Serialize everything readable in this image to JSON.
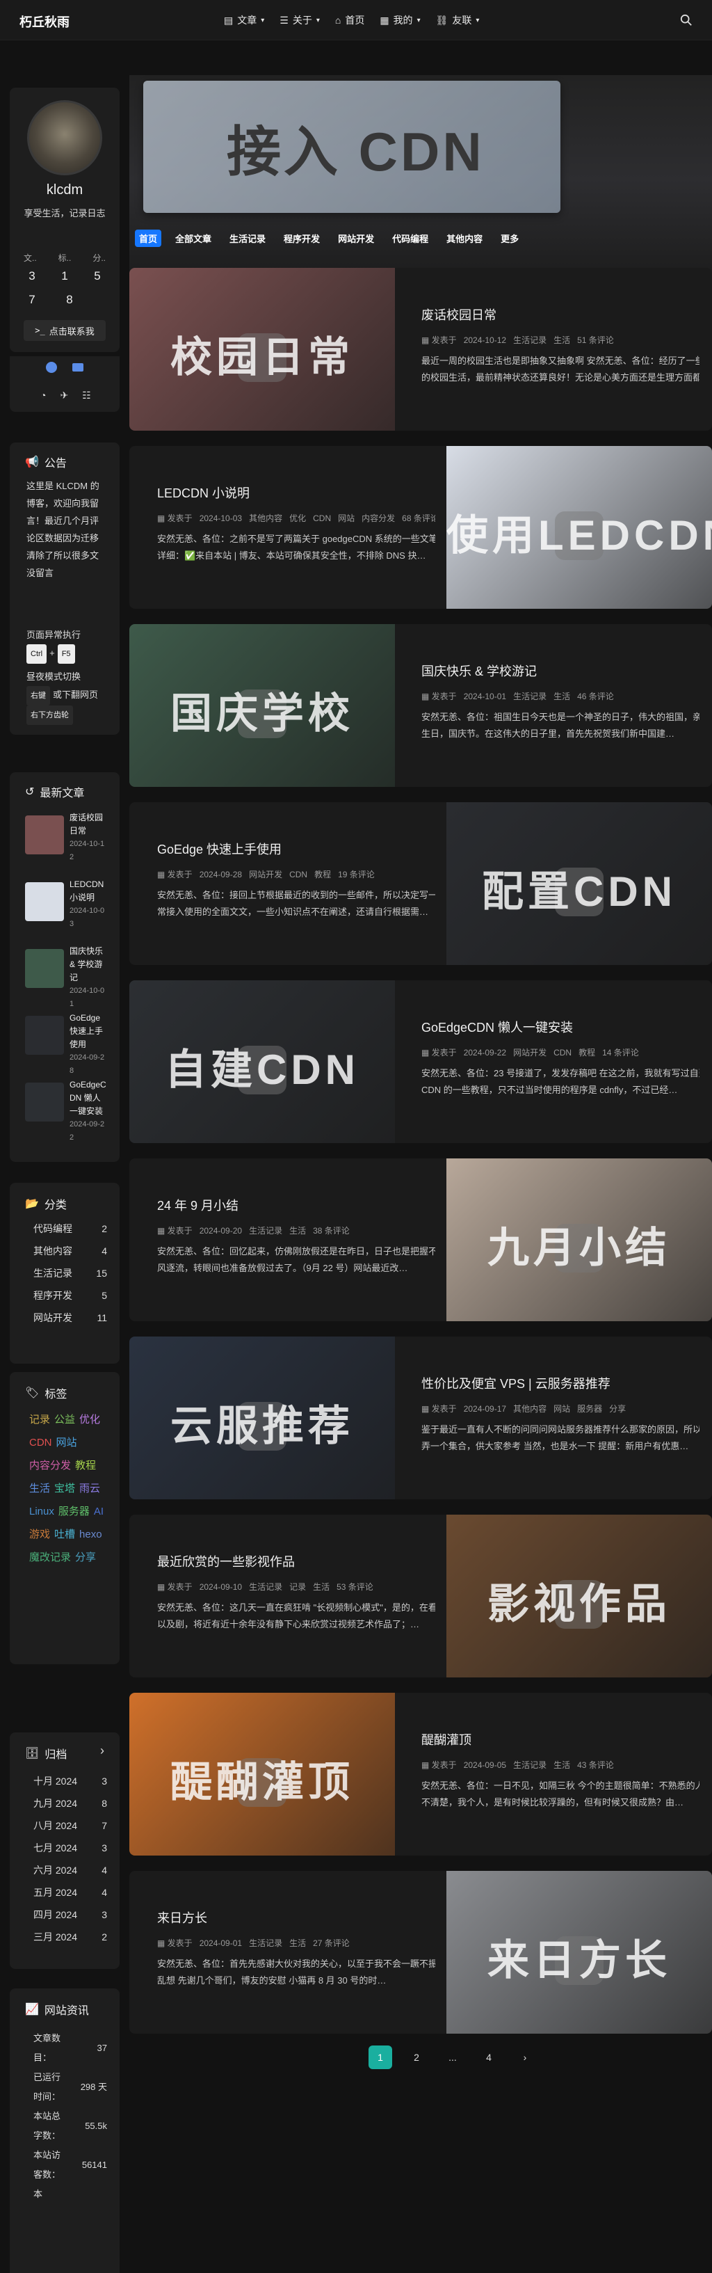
{
  "site": {
    "brand": "朽丘秋雨"
  },
  "nav": {
    "items": [
      {
        "label": "文章",
        "icon": "book-icon",
        "dropdown": true
      },
      {
        "label": "关于",
        "icon": "list-icon",
        "dropdown": true
      },
      {
        "label": "首页",
        "icon": "home-icon",
        "dropdown": false
      },
      {
        "label": "我的",
        "icon": "grid-icon",
        "dropdown": true
      },
      {
        "label": "友联",
        "icon": "link-icon",
        "dropdown": true
      }
    ]
  },
  "hero": {
    "text": "接入 CDN"
  },
  "profile": {
    "name": "klcdm",
    "bio": "享受生活，记录日志",
    "stat_labels": [
      "文..",
      "标..",
      "分.."
    ],
    "stat_values_1": [
      "3",
      "1",
      "5"
    ],
    "stat_values_2": [
      "7",
      "8"
    ],
    "contact_label": "点击联系我"
  },
  "notice": {
    "title": "公告",
    "text": "这里是 KLCDM 的博客，欢迎向我留言！最近几个月评论区数据因为迁移清除了所以很多文没留言",
    "shortcut_label": "页面异常执行",
    "key1": "Ctrl",
    "plus": "+",
    "key2": "F5",
    "theme_label": "昼夜模式切换",
    "btn1": "右键",
    "theme_rest": "或下翻网页",
    "btn2": "右下方齿轮"
  },
  "recent": {
    "title": "最新文章",
    "items": [
      {
        "title": "废话校园日常",
        "date": "2024-10-12"
      },
      {
        "title": "LEDCDN 小说明",
        "date": "2024-10-03"
      },
      {
        "title": "国庆快乐 & 学校游记",
        "date": "2024-10-01"
      },
      {
        "title": "GoEdge 快速上手使用",
        "date": "2024-09-28"
      },
      {
        "title": "GoEdgeCDN 懒人一键安装",
        "date": "2024-09-22"
      }
    ]
  },
  "categories": {
    "title": "分类",
    "items": [
      {
        "name": "代码编程",
        "count": "2"
      },
      {
        "name": "其他内容",
        "count": "4"
      },
      {
        "name": "生活记录",
        "count": "15"
      },
      {
        "name": "程序开发",
        "count": "5"
      },
      {
        "name": "网站开发",
        "count": "11"
      }
    ]
  },
  "tags": {
    "title": "标签",
    "items": [
      {
        "name": "记录",
        "color": "#c8a84a"
      },
      {
        "name": "公益",
        "color": "#7bbf5c"
      },
      {
        "name": "优化",
        "color": "#b77be0"
      },
      {
        "name": "CDN",
        "color": "#e05050"
      },
      {
        "name": "网站",
        "color": "#4aa3e0"
      },
      {
        "name": "内容分发",
        "color": "#d05fa8"
      },
      {
        "name": "教程",
        "color": "#a3d04a"
      },
      {
        "name": "生活",
        "color": "#5f8fe0"
      },
      {
        "name": "宝塔",
        "color": "#3fbfa0"
      },
      {
        "name": "雨云",
        "color": "#8a7be0"
      },
      {
        "name": "Linux",
        "color": "#4a90d0"
      },
      {
        "name": "服务器",
        "color": "#5fbf6a"
      },
      {
        "name": "AI",
        "color": "#4a70d0"
      },
      {
        "name": "游戏",
        "color": "#c87a3a"
      },
      {
        "name": "吐槽",
        "color": "#4ab0d0"
      },
      {
        "name": "hexo",
        "color": "#6a8ad0"
      },
      {
        "name": "魔改记录",
        "color": "#4ab07a"
      },
      {
        "name": "分享",
        "color": "#4aa0c0"
      }
    ]
  },
  "archive": {
    "title": "归档",
    "items": [
      {
        "month": "十月 2024",
        "count": "3"
      },
      {
        "month": "九月 2024",
        "count": "8"
      },
      {
        "month": "八月 2024",
        "count": "7"
      },
      {
        "month": "七月 2024",
        "count": "3"
      },
      {
        "month": "六月 2024",
        "count": "4"
      },
      {
        "month": "五月 2024",
        "count": "4"
      },
      {
        "month": "四月 2024",
        "count": "3"
      },
      {
        "month": "三月 2024",
        "count": "2"
      }
    ]
  },
  "siteinfo": {
    "title": "网站资讯",
    "items": [
      {
        "label": "文章数目：",
        "value": "37"
      },
      {
        "label": "已运行时间：",
        "value": "298 天"
      },
      {
        "label": "本站总字数：",
        "value": "55.5k"
      },
      {
        "label": "本站访客数：",
        "value": "56141"
      },
      {
        "label": "本",
        "value": ""
      }
    ]
  },
  "tabs": [
    "首页",
    "全部文章",
    "生活记录",
    "程序开发",
    "网站开发",
    "代码编程",
    "其他内容",
    "更多"
  ],
  "posts": [
    {
      "title": "废话校园日常",
      "date": "2024-10-12",
      "category": "生活记录",
      "tags": [
        "生活"
      ],
      "comments": "51 条评论",
      "excerpt": "最近一周的校园生活也是即抽象又抽象啊 安然无恙、各位：经历了一些学校的校园生活，最前精神状态还算良好！无论是心美方面还是生理方面都…",
      "thumb": "校园日常",
      "thumb_bg": "#7a5050",
      "side": "left"
    },
    {
      "title": "LEDCDN 小说明",
      "date": "2024-10-03",
      "category": "其他内容",
      "tags": [
        "优化",
        "CDN",
        "网站",
        "内容分发"
      ],
      "comments": "68 条评论",
      "excerpt": "安然无恙、各位：之前不是写了两篇关于 goedgeCDN 系统的一些文笔吗，详细：✅来自本站 | 博友、本站可确保其安全性，不排除 DNS 抉…",
      "thumb": "使用LEDCDN",
      "thumb_bg": "#d8dde6",
      "side": "right"
    },
    {
      "title": "国庆快乐 & 学校游记",
      "date": "2024-10-01",
      "category": "生活记录",
      "tags": [
        "生活"
      ],
      "comments": "46 条评论",
      "excerpt": "安然无恙、各位：祖国生日今天也是一个神圣的日子，伟大的祖国，亲爱的生日，国庆节。在这伟大的日子里，首先先祝贺我们新中国建…",
      "thumb": "国庆学校",
      "thumb_bg": "#3e5a4a",
      "side": "left"
    },
    {
      "title": "GoEdge 快速上手使用",
      "date": "2024-09-28",
      "category": "网站开发",
      "tags": [
        "CDN",
        "教程"
      ],
      "comments": "19 条评论",
      "excerpt": "安然无恙、各位：接回上节根据最近的收到的一些邮件，所以决定写一篇正常接入使用的全面文文，一些小知识点不在阐述，还请自行根据需…",
      "thumb": "配置CDN",
      "thumb_bg": "#2a2c30",
      "side": "right"
    },
    {
      "title": "GoEdgeCDN 懒人一键安装",
      "date": "2024-09-22",
      "category": "网站开发",
      "tags": [
        "CDN",
        "教程"
      ],
      "comments": "14 条评论",
      "excerpt": "安然无恙、各位：23 号接道了，发发存稿吧 在这之前，我就有写过自建 CDN 的一些教程，只不过当时使用的程序是 cdnfly，不过已经…",
      "thumb": "自建CDN",
      "thumb_bg": "#2c2f33",
      "side": "left"
    },
    {
      "title": "24 年 9 月小结",
      "date": "2024-09-20",
      "category": "生活记录",
      "tags": [
        "生活"
      ],
      "comments": "38 条评论",
      "excerpt": "安然无恙、各位：回忆起来，仿佛刚放假还是在昨日，日子也是把握不住随风逐流，转眼间也准备放假过去了。（9月 22 号）网站最近改…",
      "thumb": "九月小结",
      "thumb_bg": "#b8a89a",
      "side": "right"
    },
    {
      "title": "性价比及便宜 VPS | 云服务器推荐",
      "date": "2024-09-17",
      "category": "其他内容",
      "tags": [
        "网站",
        "服务器",
        "分享"
      ],
      "comments": "",
      "excerpt": "鉴于最近一直有人不断的问同问网站服务器推荐什么那家的原因，所以就的弄一个集合，供大家参考 当然，也是水一下 提醒：新用户有优惠…",
      "thumb": "云服推荐",
      "thumb_bg": "#2a3240",
      "side": "left"
    },
    {
      "title": "最近欣赏的一些影视作品",
      "date": "2024-09-10",
      "category": "生活记录",
      "tags": [
        "记录",
        "生活"
      ],
      "comments": "53 条评论",
      "excerpt": "安然无恙、各位：这几天一直在疯狂啃 \"长视频制心模式\"，是的，在看电影以及剧，将近有近十余年没有静下心来欣赏过视频艺术作品了；…",
      "thumb": "影视作品",
      "thumb_bg": "#6a4a30",
      "side": "right"
    },
    {
      "title": "醍醐灌顶",
      "date": "2024-09-05",
      "category": "生活记录",
      "tags": [
        "生活"
      ],
      "comments": "43 条评论",
      "excerpt": "安然无恙、各位：一日不见，如隔三秋 今个的主题很简单：不熟悉的人可能不清楚，我个人，是有时候比较浮躁的，但有时候又很成熟？由…",
      "thumb": "醍醐灌顶",
      "thumb_bg": "#d0702a",
      "side": "left"
    },
    {
      "title": "来日方长",
      "date": "2024-09-01",
      "category": "生活记录",
      "tags": [
        "生活"
      ],
      "comments": "27 条评论",
      "excerpt": "安然无恙、各位：首先先感谢大伙对我的关心，以至于我不会一蹶不振沉思乱想 先谢几个哥们，博友的安慰 小猫再 8 月 30 号的时…",
      "thumb": "来日方长",
      "thumb_bg": "#8a8c90",
      "side": "right"
    }
  ],
  "pager": {
    "pages": [
      "1",
      "2",
      "...",
      "4"
    ],
    "next": "›"
  }
}
